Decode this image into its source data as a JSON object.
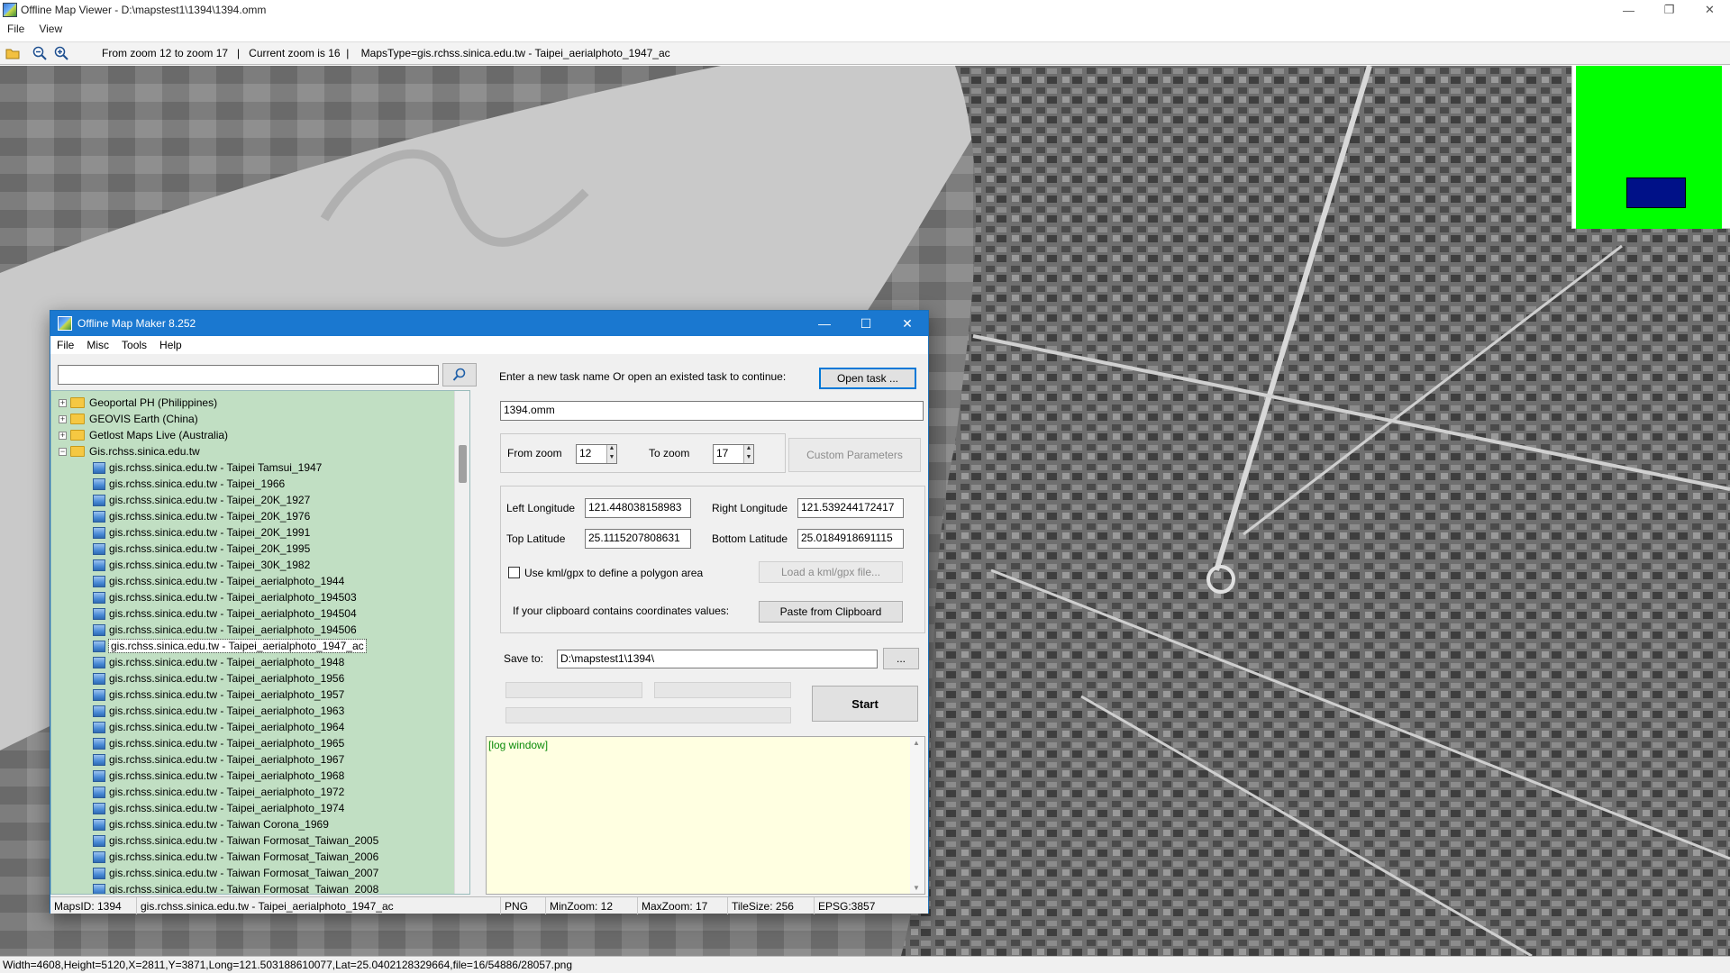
{
  "window": {
    "title": "Offline Map Viewer - D:\\mapstest1\\1394\\1394.omm",
    "controls": {
      "minimize": "—",
      "maximize": "❐",
      "close": "✕"
    }
  },
  "menu": {
    "file": "File",
    "view": "View"
  },
  "toolbar": {
    "info": "From zoom 12 to zoom 17   |   Current zoom is 16  |    MapsType=gis.rchss.sinica.edu.tw - Taipei_aerialphoto_1947_ac"
  },
  "statusbar": {
    "text": "Width=4608,Height=5120,X=2811,Y=3871,Long=121.503188610077,Lat=25.0402128329664,file=16/54886/28057.png"
  },
  "maker": {
    "title": "Offline Map Maker 8.252",
    "controls": {
      "minimize": "—",
      "maximize": "☐",
      "close": "✕"
    },
    "menu": {
      "file": "File",
      "misc": "Misc",
      "tools": "Tools",
      "help": "Help"
    },
    "search": {
      "value": ""
    },
    "tree": {
      "groups": [
        {
          "label": "Geoportal PH (Philippines)",
          "expander": "+"
        },
        {
          "label": "GEOVIS Earth (China)",
          "expander": "+"
        },
        {
          "label": "Getlost Maps Live (Australia)",
          "expander": "+"
        },
        {
          "label": "Gis.rchss.sinica.edu.tw",
          "expander": "−"
        }
      ],
      "items": [
        "gis.rchss.sinica.edu.tw - Taipei Tamsui_1947",
        "gis.rchss.sinica.edu.tw - Taipei_1966",
        "gis.rchss.sinica.edu.tw - Taipei_20K_1927",
        "gis.rchss.sinica.edu.tw - Taipei_20K_1976",
        "gis.rchss.sinica.edu.tw - Taipei_20K_1991",
        "gis.rchss.sinica.edu.tw - Taipei_20K_1995",
        "gis.rchss.sinica.edu.tw - Taipei_30K_1982",
        "gis.rchss.sinica.edu.tw - Taipei_aerialphoto_1944",
        "gis.rchss.sinica.edu.tw - Taipei_aerialphoto_194503",
        "gis.rchss.sinica.edu.tw - Taipei_aerialphoto_194504",
        "gis.rchss.sinica.edu.tw - Taipei_aerialphoto_194506",
        "gis.rchss.sinica.edu.tw - Taipei_aerialphoto_1947_ac",
        "gis.rchss.sinica.edu.tw - Taipei_aerialphoto_1948",
        "gis.rchss.sinica.edu.tw - Taipei_aerialphoto_1956",
        "gis.rchss.sinica.edu.tw - Taipei_aerialphoto_1957",
        "gis.rchss.sinica.edu.tw - Taipei_aerialphoto_1963",
        "gis.rchss.sinica.edu.tw - Taipei_aerialphoto_1964",
        "gis.rchss.sinica.edu.tw - Taipei_aerialphoto_1965",
        "gis.rchss.sinica.edu.tw - Taipei_aerialphoto_1967",
        "gis.rchss.sinica.edu.tw - Taipei_aerialphoto_1968",
        "gis.rchss.sinica.edu.tw - Taipei_aerialphoto_1972",
        "gis.rchss.sinica.edu.tw - Taipei_aerialphoto_1974",
        "gis.rchss.sinica.edu.tw - Taiwan Corona_1969",
        "gis.rchss.sinica.edu.tw - Taiwan Formosat_Taiwan_2005",
        "gis.rchss.sinica.edu.tw - Taiwan Formosat_Taiwan_2006",
        "gis.rchss.sinica.edu.tw - Taiwan Formosat_Taiwan_2007",
        "gis.rchss.sinica.edu.tw - Taiwan Formosat_Taiwan_2008"
      ],
      "selected_item": "gis.rchss.sinica.edu.tw - Taipei_aerialphoto_1947_ac"
    },
    "task": {
      "prompt": "Enter a new task name Or open an existed task to continue:",
      "open_button": "Open task ...",
      "name_value": "1394.omm"
    },
    "zoom": {
      "from_label": "From zoom",
      "from_value": "12",
      "to_label": "To zoom",
      "to_value": "17",
      "custom_button": "Custom Parameters"
    },
    "coords": {
      "left_lon_label": "Left Longitude",
      "left_lon_value": "121.448038158983",
      "right_lon_label": "Right Longitude",
      "right_lon_value": "121.539244172417",
      "top_lat_label": "Top Latitude",
      "top_lat_value": "25.1115207808631",
      "bottom_lat_label": "Bottom Latitude",
      "bottom_lat_value": "25.0184918691115",
      "kml_label": "Use kml/gpx to define a polygon area",
      "kml_button": "Load a kml/gpx file...",
      "clipboard_label": "If your clipboard contains coordinates values:",
      "clipboard_button": "Paste from Clipboard"
    },
    "save": {
      "label": "Save to:",
      "value": "D:\\mapstest1\\1394\\",
      "browse": "...",
      "start": "Start"
    },
    "log": {
      "text": "[log window]"
    },
    "status": {
      "maps_id": "MapsID: 1394",
      "maps_name": "gis.rchss.sinica.edu.tw - Taipei_aerialphoto_1947_ac",
      "format": "PNG",
      "min_zoom": "MinZoom: 12",
      "max_zoom": "MaxZoom: 17",
      "tile_size": "TileSize: 256",
      "epsg": "EPSG:3857"
    }
  }
}
